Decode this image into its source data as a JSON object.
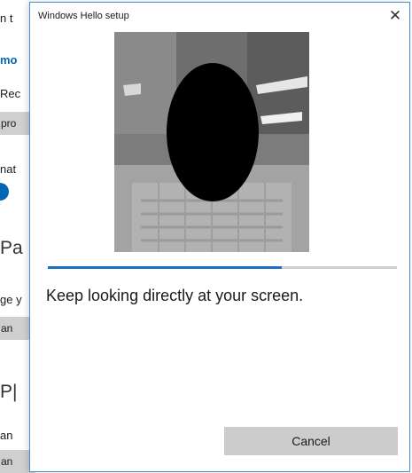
{
  "background_window": {
    "items": [
      {
        "text": "n t"
      },
      {
        "text": "mo"
      },
      {
        "text": "Rec"
      },
      {
        "text": "pro"
      },
      {
        "text": "nat"
      },
      {
        "text": "Pa"
      },
      {
        "text": "ge y"
      },
      {
        "text": "an"
      },
      {
        "text": "P|"
      },
      {
        "text": "an"
      },
      {
        "text": "an"
      }
    ]
  },
  "dialog": {
    "title": "Windows Hello setup",
    "close_glyph": "✕",
    "camera_feed": {
      "face_obscured": true
    },
    "progress_fraction": 0.67,
    "instruction": "Keep looking directly at your screen.",
    "cancel_label": "Cancel"
  },
  "colors": {
    "accent": "#0067b8",
    "progress": "#1f6fbf",
    "button_bg": "#cccccc"
  }
}
